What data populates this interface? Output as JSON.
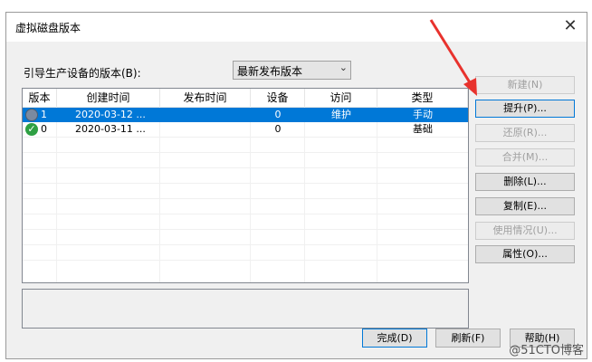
{
  "window": {
    "title": "虚拟磁盘版本",
    "close_glyph": "✕"
  },
  "boot_version": {
    "label": "引导生产设备的版本(B):",
    "selected": "最新发布版本"
  },
  "table": {
    "headers": [
      "版本",
      "创建时间",
      "发布时间",
      "设备",
      "访问",
      "类型"
    ],
    "rows": [
      {
        "version": "1",
        "created": "2020-03-12 ...",
        "published": "",
        "devices": "0",
        "access": "维护",
        "type": "手动",
        "icon": "gear-icon",
        "selected": true
      },
      {
        "version": "0",
        "created": "2020-03-11 ...",
        "published": "",
        "devices": "0",
        "access": "",
        "type": "基础",
        "icon": "check-icon",
        "selected": false
      }
    ]
  },
  "side_buttons": {
    "new": "新建(N)",
    "promote": "提升(P)...",
    "revert": "还原(R)...",
    "merge": "合并(M)...",
    "delete": "删除(L)...",
    "copy": "复制(E)...",
    "usage": "使用情况(U)...",
    "properties": "属性(O)..."
  },
  "bottom_buttons": {
    "done": "完成(D)",
    "refresh": "刷新(F)",
    "help": "帮助(H)"
  },
  "watermark": "@51CTO博客",
  "colors": {
    "selection": "#0078d7",
    "arrow": "#e8322d"
  }
}
